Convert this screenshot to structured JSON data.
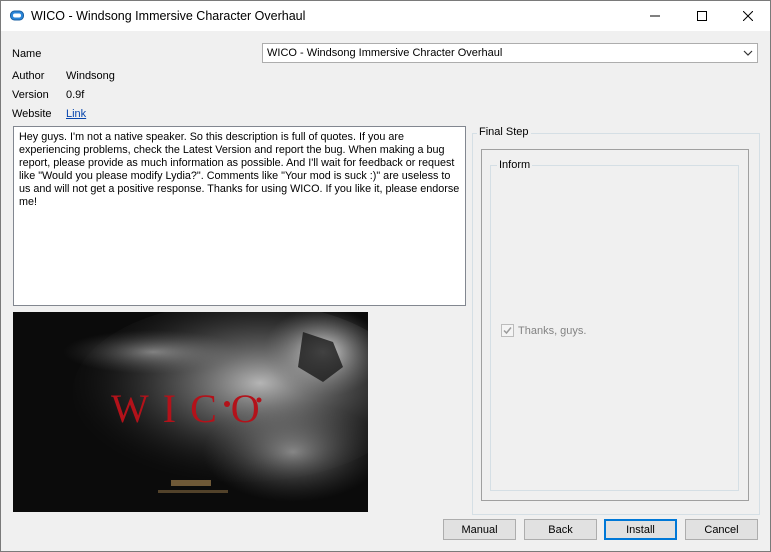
{
  "window": {
    "title": "WICO - Windsong Immersive Character Overhaul"
  },
  "fields": {
    "name_label": "Name",
    "name_value": "WICO - Windsong Immersive Chracter Overhaul",
    "author_label": "Author",
    "author_value": "Windsong",
    "version_label": "Version",
    "version_value": "0.9f",
    "website_label": "Website",
    "website_link": "Link"
  },
  "description": "Hey guys. I'm not a native speaker. So this description is full of quotes. If you are experiencing problems, check the Latest Version and report the bug. When making a bug report, please provide as much information as possible. And I'll wait for feedback or request like \"Would you please modify Lydia?\". Comments like \"Your mod is suck :)\" are useless to us and will not get a positive response. Thanks for using WICO. If you like it, please endorse me!",
  "preview": {
    "logo_text": "WICO"
  },
  "step": {
    "title": "Final Step",
    "group_title": "Inform",
    "option_label": "Thanks, guys.",
    "option_checked": true,
    "option_enabled": false
  },
  "buttons": {
    "manual": "Manual",
    "back": "Back",
    "install": "Install",
    "cancel": "Cancel"
  },
  "colors": {
    "link": "#0645ad",
    "default_button_border": "#0078d7",
    "wico_red": "#b3121a"
  }
}
